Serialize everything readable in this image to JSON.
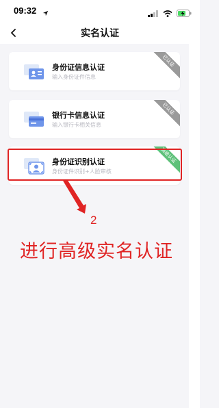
{
  "status_bar": {
    "time": "09:32"
  },
  "nav": {
    "title": "实名认证"
  },
  "cards": [
    {
      "title": "身份证信息认证",
      "desc": "输入身份证件信息",
      "badge": "已认证"
    },
    {
      "title": "银行卡信息认证",
      "desc": "输入银行卡相关信息",
      "badge": "已认证"
    },
    {
      "title": "身份证识别认证",
      "desc": "身份证件识别+人脸审核",
      "badge": "高级认证"
    }
  ],
  "annotation": {
    "step": "2",
    "text": "进行高级实名认证"
  },
  "colors": {
    "accent_red": "#e02424",
    "badge_grey": "#9a9a9a",
    "badge_green": "#5ec17a",
    "icon_blue": "#4a7bef"
  }
}
